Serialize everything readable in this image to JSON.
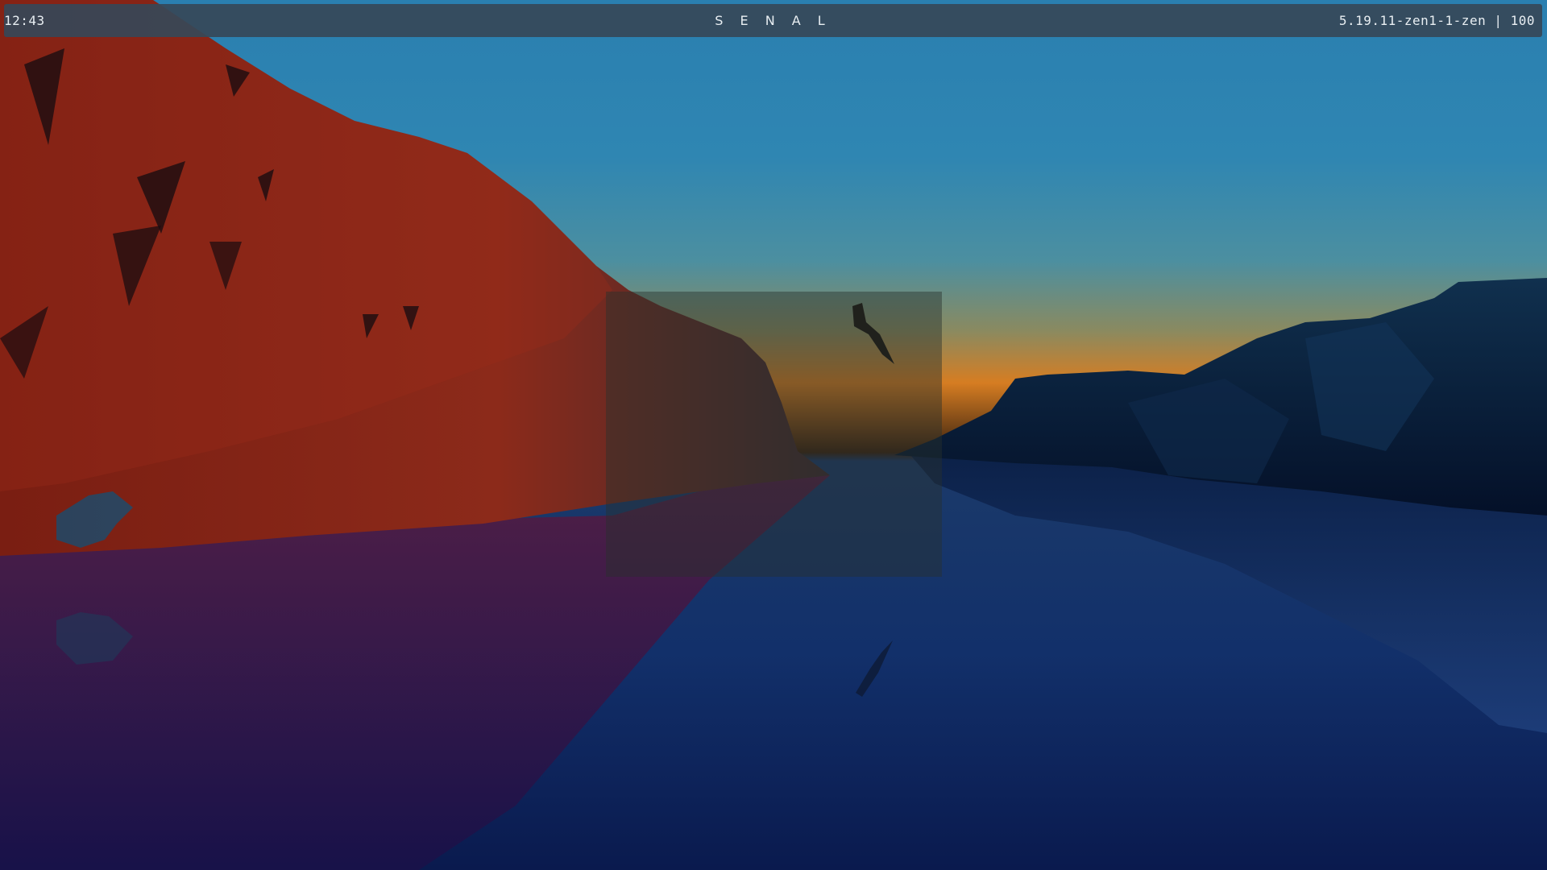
{
  "topbar": {
    "clock": "12:43",
    "workspace_title": "S E N A L",
    "status": "5.19.11-zen1-1-zen | 100"
  },
  "wallpaper": {
    "description_icon": "landscape-wallpaper"
  },
  "colors": {
    "bar_bg": "#364858",
    "bar_text": "#e8eef2",
    "sky_top": "#2a7aa8",
    "horizon": "#d97a20",
    "water": "#0a1a50",
    "cliff_red": "#8a2418"
  }
}
